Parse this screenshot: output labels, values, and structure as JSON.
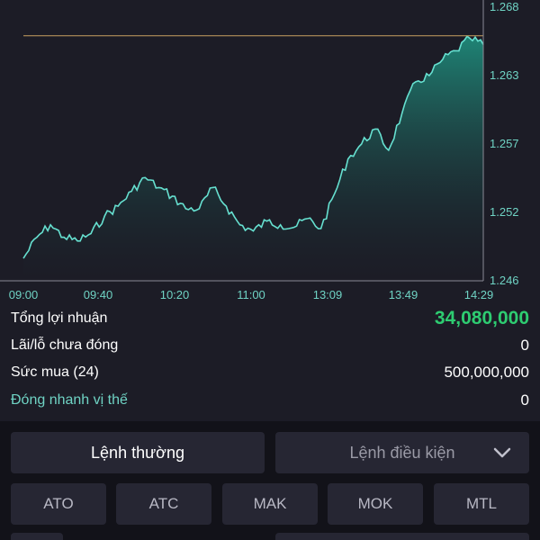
{
  "chart": {
    "y_ticks": [
      "1.268",
      "1.263",
      "1.257",
      "1.252",
      "1.246"
    ],
    "x_ticks": [
      "09:00",
      "09:40",
      "10:20",
      "11:00",
      "13:09",
      "13:49",
      "14:29"
    ],
    "ref_line_value": 1.2657,
    "colors": {
      "line": "#66e0d0",
      "fill_top": "#1f8a7a",
      "ref_line": "#c8a060",
      "axis": "#6fd3c4"
    }
  },
  "chart_data": {
    "type": "area",
    "title": "",
    "xlabel": "",
    "ylabel": "",
    "ylim": [
      1.246,
      1.268
    ],
    "x": [
      "09:00",
      "09:40",
      "10:20",
      "11:00",
      "13:09",
      "13:49",
      "14:29"
    ],
    "series": [
      {
        "values": [
          1.2478,
          1.2495,
          1.2505,
          1.2495,
          1.2492,
          1.2498,
          1.2512,
          1.252,
          1.2532,
          1.2543,
          1.2535,
          1.2528,
          1.2518,
          1.2518,
          1.2535,
          1.252,
          1.2505,
          1.25,
          1.2508,
          1.2505,
          1.2503,
          1.251,
          1.2502,
          1.253,
          1.2558,
          1.257,
          1.2582,
          1.2565,
          1.2595,
          1.262,
          1.2625,
          1.2638,
          1.2645,
          1.2655,
          1.265
        ]
      }
    ]
  },
  "stats": {
    "total_profit_label": "Tổng lợi nhuận",
    "total_profit_value": "34,080,000",
    "unrealized_label": "Lãi/lỗ chưa đóng",
    "unrealized_value": "0",
    "buying_power_label": "Sức mua (24)",
    "buying_power_value": "500,000,000",
    "quick_close_label": "Đóng nhanh vị thế",
    "quick_close_value": "0"
  },
  "order": {
    "normal_label": "Lệnh thường",
    "conditional_label": "Lệnh điều kiện",
    "chevron_icon": "chevron-down-icon",
    "types": [
      "ATO",
      "ATC",
      "MAK",
      "MOK",
      "MTL"
    ]
  }
}
